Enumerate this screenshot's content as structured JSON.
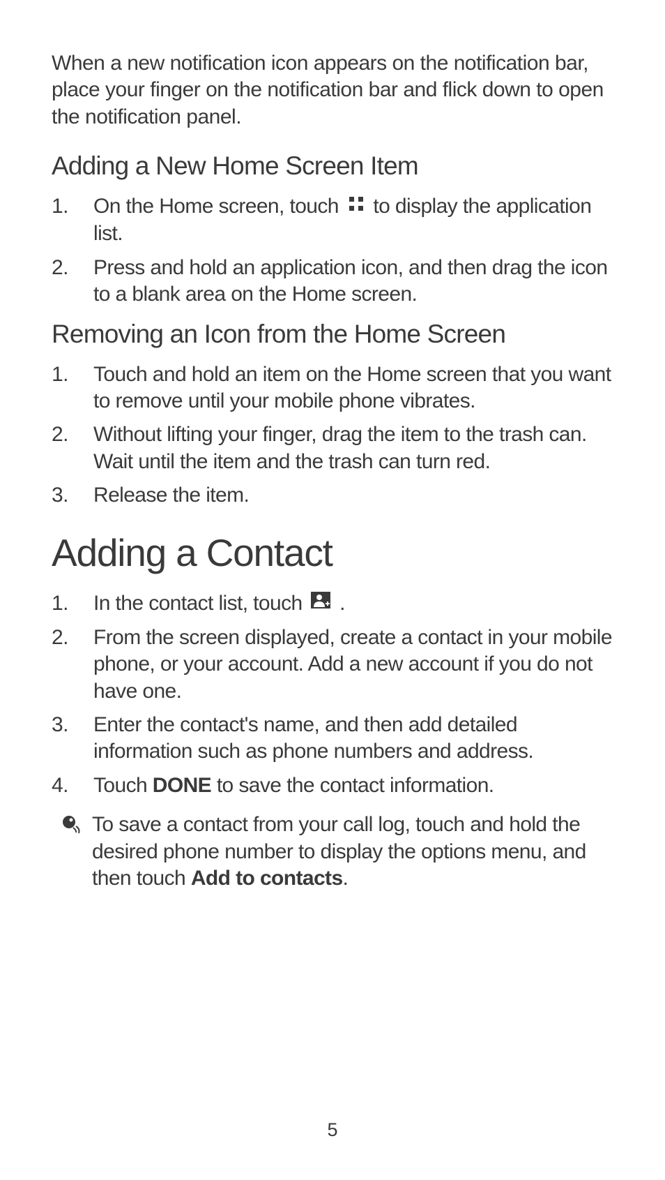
{
  "intro_paragraph": "When a new notification icon appears on the notification bar, place your finger on the notification bar and flick down to open the notification panel.",
  "section_adding_home": {
    "heading": "Adding a New Home Screen Item",
    "items": [
      {
        "pre": "On the Home screen, touch ",
        "post": " to display the application list."
      },
      "Press and hold an application icon, and then drag the icon to a blank area on the Home screen."
    ]
  },
  "section_removing": {
    "heading": "Removing an Icon from the Home Screen",
    "items": [
      "Touch and hold an item on the Home screen that you want to remove until your mobile phone vibrates.",
      "Without lifting your finger, drag the item to the trash can. Wait until the item and the trash can turn red.",
      "Release the item."
    ]
  },
  "section_contact": {
    "heading": "Adding a Contact",
    "items": [
      {
        "pre": "In the contact list, touch ",
        "post": " ."
      },
      "From the screen displayed, create a contact in your mobile phone, or your account. Add a new account if you do not have one.",
      "Enter the contact's name, and then add detailed information such as phone numbers and address.",
      {
        "pre": "Touch ",
        "bold": "DONE",
        "post": " to save the contact information."
      }
    ],
    "tip": {
      "pre": "To save a contact from your call log, touch and hold the desired phone number to display the options menu, and then touch ",
      "bold": "Add to contacts",
      "post": "."
    }
  },
  "page_number": "5"
}
